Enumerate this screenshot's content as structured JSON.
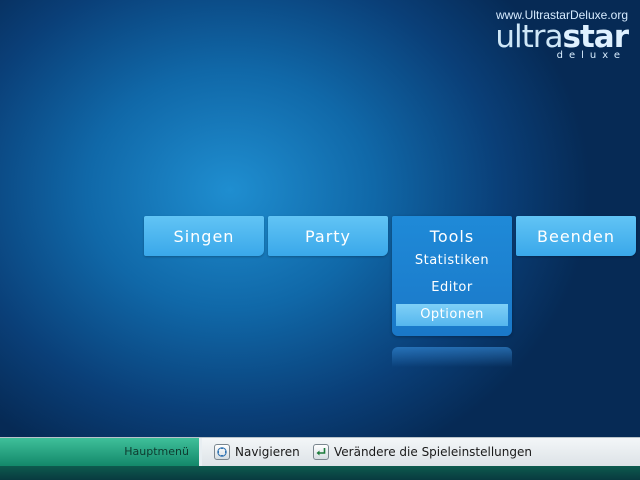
{
  "brand": {
    "url": "www.UltrastarDeluxe.org",
    "logo_part1": "ultra",
    "logo_part2": "star",
    "subtitle": "deluxe"
  },
  "main_menu": {
    "buttons": [
      {
        "label": "Singen"
      },
      {
        "label": "Party"
      },
      {
        "label": "Tools"
      },
      {
        "label": "Beenden"
      }
    ],
    "selected": "Tools",
    "tools_submenu": {
      "items": [
        {
          "label": "Statistiken"
        },
        {
          "label": "Editor"
        },
        {
          "label": "Optionen"
        }
      ],
      "highlighted": "Optionen"
    }
  },
  "bottom_bar": {
    "title": "Hauptmenü",
    "hints": [
      {
        "icon": "dpad-icon",
        "label": "Navigieren"
      },
      {
        "icon": "enter-icon",
        "label": "Verändere die Spieleinstellungen"
      }
    ]
  },
  "colors": {
    "button": "#3aa8ea",
    "selected_panel": "#1a78c8",
    "highlight": "#7fd0f7",
    "bar_title": "#13886a"
  }
}
